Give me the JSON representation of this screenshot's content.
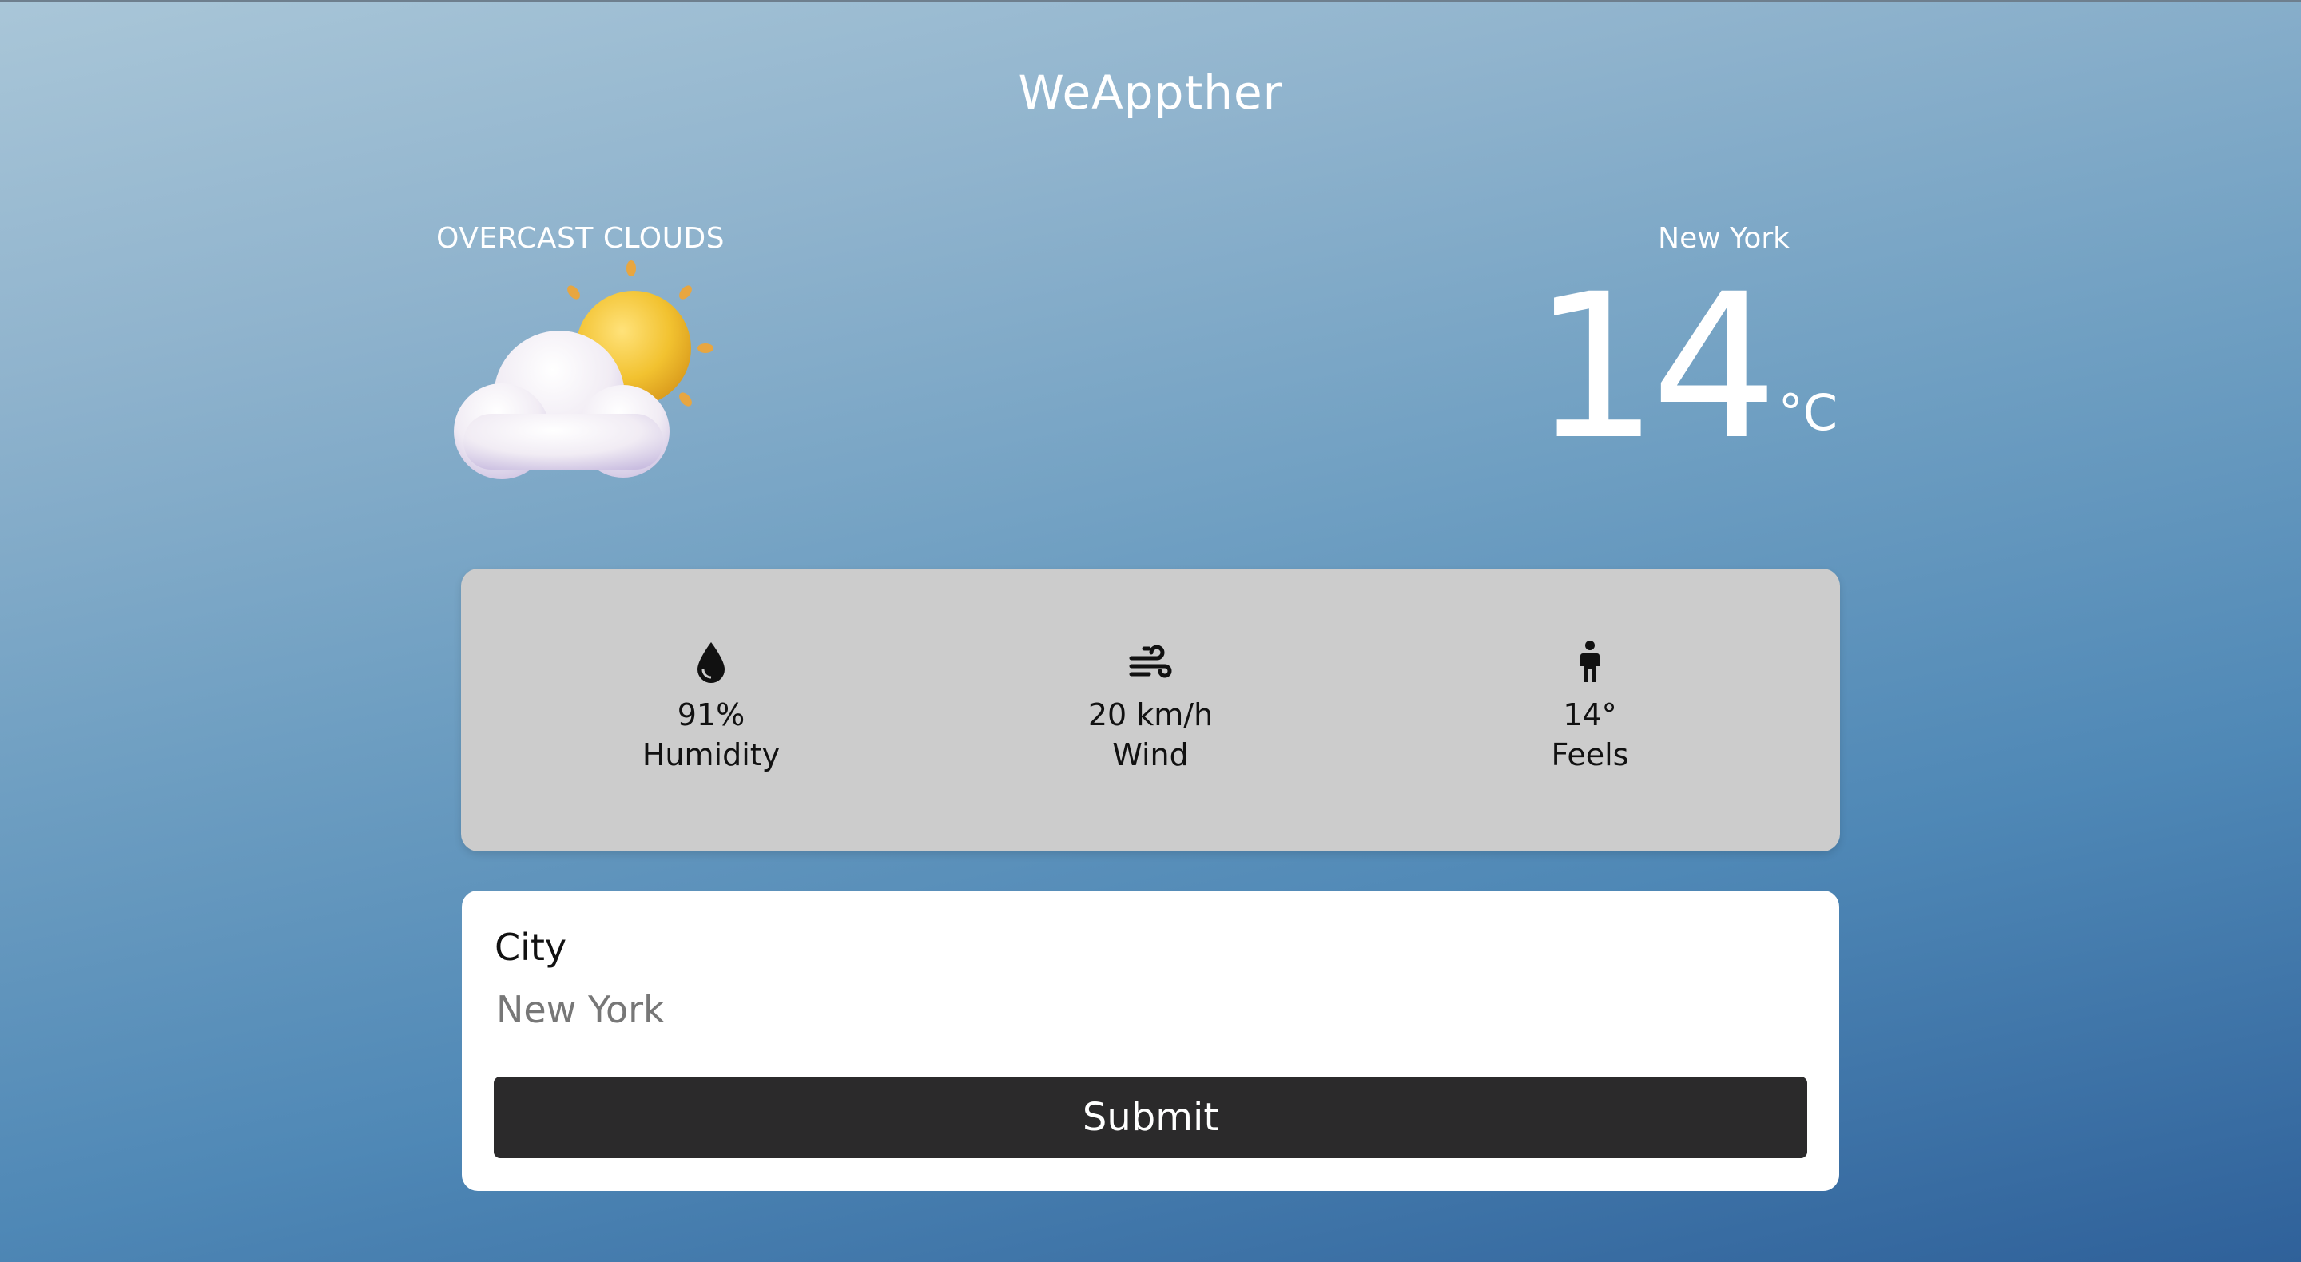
{
  "app": {
    "title": "WeAppther"
  },
  "current": {
    "condition": "OVERCAST CLOUDS",
    "condition_icon": "cloud-sun-icon",
    "city": "New York",
    "temperature": "14",
    "unit": "°C"
  },
  "stats": [
    {
      "icon": "water-drop-icon",
      "value": "91%",
      "label": "Humidity"
    },
    {
      "icon": "wind-icon",
      "value": "20 km/h",
      "label": "Wind"
    },
    {
      "icon": "person-icon",
      "value": "14°",
      "label": "Feels"
    }
  ],
  "form": {
    "city_label": "City",
    "city_value": "New York",
    "submit_label": "Submit"
  },
  "colors": {
    "card_gray": "#cccccc",
    "button_dark": "#2b2a2b",
    "sun_yellow": "#f2c230"
  }
}
